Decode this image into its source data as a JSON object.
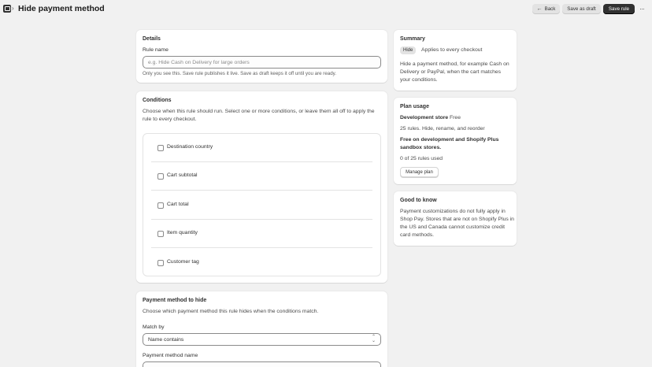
{
  "header": {
    "title": "Hide payment method",
    "back_label": "Back",
    "save_draft_label": "Save as draft",
    "save_rule_label": "Save rule",
    "more_icon": "ellipsis-icon"
  },
  "details": {
    "title": "Details",
    "rule_name_label": "Rule name",
    "rule_name_placeholder": "e.g. Hide Cash on Delivery for large orders",
    "rule_name_value": "",
    "help": "Only you see this. Save rule publishes it live. Save as draft keeps it off until you are ready."
  },
  "conditions": {
    "title": "Conditions",
    "description": "Choose when this rule should run. Select one or more conditions, or leave them all off to apply the rule to every checkout.",
    "items": [
      {
        "label": "Destination country",
        "checked": false
      },
      {
        "label": "Cart subtotal",
        "checked": false
      },
      {
        "label": "Cart total",
        "checked": false
      },
      {
        "label": "Item quantity",
        "checked": false
      },
      {
        "label": "Customer tag",
        "checked": false
      }
    ]
  },
  "payment_method": {
    "title": "Payment method to hide",
    "description": "Choose which payment method this rule hides when the conditions match.",
    "match_by_label": "Match by",
    "match_by_value": "Name contains",
    "name_label": "Payment method name"
  },
  "summary": {
    "title": "Summary",
    "badge": "Hide",
    "applies": "Applies to every checkout",
    "description": "Hide a payment method, for example Cash on Delivery or PayPal, when the cart matches your conditions."
  },
  "plan_usage": {
    "title": "Plan usage",
    "store_label": "Development store",
    "store_plan": "Free",
    "rules_info": "25 rules. Hide, rename, and reorder",
    "free_note": "Free on development and Shopify Plus sandbox stores.",
    "usage": "0 of 25 rules used",
    "manage_label": "Manage plan"
  },
  "good_to_know": {
    "title": "Good to know",
    "text": "Payment customizations do not fully apply in Shop Pay. Stores that are not on Shopify Plus in the US and Canada cannot customize credit card methods."
  }
}
